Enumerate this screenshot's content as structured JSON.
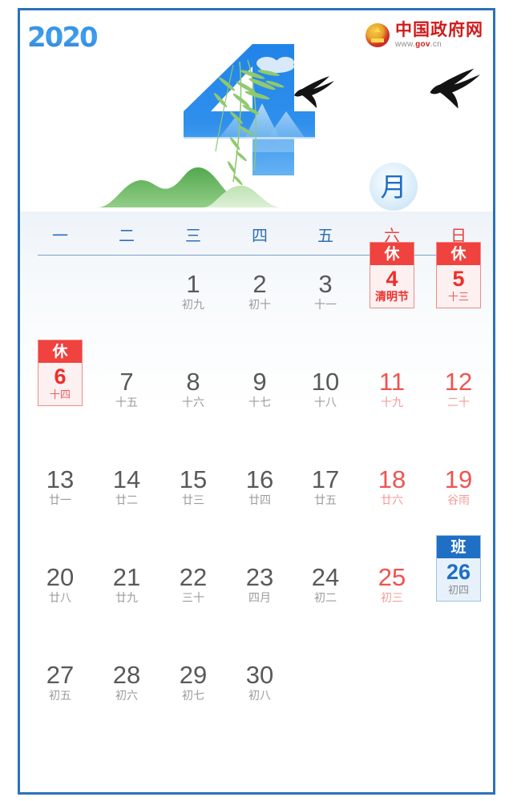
{
  "header": {
    "year_logo": "2020",
    "month_label": "月",
    "month_number": "4",
    "gov_logo": {
      "title": "中国政府网",
      "url_prefix": "www.",
      "url_mid": "gov",
      "url_suffix": ".cn"
    }
  },
  "weekdays": [
    {
      "label": "一",
      "weekend": false
    },
    {
      "label": "二",
      "weekend": false
    },
    {
      "label": "三",
      "weekend": false
    },
    {
      "label": "四",
      "weekend": false
    },
    {
      "label": "五",
      "weekend": false
    },
    {
      "label": "六",
      "weekend": true
    },
    {
      "label": "日",
      "weekend": true
    }
  ],
  "colors": {
    "frame": "#2a72bb",
    "weekday_blue": "#2f6fb5",
    "weekend_red": "#e8433f",
    "rest_red": "#f0423f",
    "work_blue": "#1f6fc4",
    "day_gray": "#59595b",
    "lunar_gray": "#9b9b9b"
  },
  "days": [
    {
      "num": "1",
      "lunar": "初九",
      "col": 4,
      "row": 1,
      "type": "normal"
    },
    {
      "num": "2",
      "lunar": "初十",
      "col": 5,
      "row": 1,
      "type": "normal"
    },
    {
      "num": "3",
      "lunar": "十一",
      "col": 6,
      "row": 1,
      "type": "normal"
    },
    {
      "num": "4",
      "lunar": "清明节",
      "tag": "休",
      "col": 7,
      "row": 1,
      "type": "rest",
      "festival": true
    },
    {
      "num": "5",
      "lunar": "十三",
      "tag": "休",
      "col": 8,
      "row": 1,
      "type": "rest"
    },
    {
      "num": "6",
      "lunar": "十四",
      "tag": "休",
      "col": 2,
      "row": 2,
      "type": "rest"
    },
    {
      "num": "7",
      "lunar": "十五",
      "col": 3,
      "row": 2,
      "type": "normal"
    },
    {
      "num": "8",
      "lunar": "十六",
      "col": 4,
      "row": 2,
      "type": "normal"
    },
    {
      "num": "9",
      "lunar": "十七",
      "col": 5,
      "row": 2,
      "type": "normal"
    },
    {
      "num": "10",
      "lunar": "十八",
      "col": 6,
      "row": 2,
      "type": "normal"
    },
    {
      "num": "11",
      "lunar": "十九",
      "col": 7,
      "row": 2,
      "type": "weekend"
    },
    {
      "num": "12",
      "lunar": "二十",
      "col": 8,
      "row": 2,
      "type": "weekend"
    },
    {
      "num": "13",
      "lunar": "廿一",
      "col": 2,
      "row": 3,
      "type": "normal"
    },
    {
      "num": "14",
      "lunar": "廿二",
      "col": 3,
      "row": 3,
      "type": "normal"
    },
    {
      "num": "15",
      "lunar": "廿三",
      "col": 4,
      "row": 3,
      "type": "normal"
    },
    {
      "num": "16",
      "lunar": "廿四",
      "col": 5,
      "row": 3,
      "type": "normal"
    },
    {
      "num": "17",
      "lunar": "廿五",
      "col": 6,
      "row": 3,
      "type": "normal"
    },
    {
      "num": "18",
      "lunar": "廿六",
      "col": 7,
      "row": 3,
      "type": "weekend"
    },
    {
      "num": "19",
      "lunar": "谷雨",
      "col": 8,
      "row": 3,
      "type": "weekend"
    },
    {
      "num": "20",
      "lunar": "廿八",
      "col": 2,
      "row": 4,
      "type": "normal"
    },
    {
      "num": "21",
      "lunar": "廿九",
      "col": 3,
      "row": 4,
      "type": "normal"
    },
    {
      "num": "22",
      "lunar": "三十",
      "col": 4,
      "row": 4,
      "type": "normal"
    },
    {
      "num": "23",
      "lunar": "四月",
      "col": 5,
      "row": 4,
      "type": "normal"
    },
    {
      "num": "24",
      "lunar": "初二",
      "col": 6,
      "row": 4,
      "type": "normal"
    },
    {
      "num": "25",
      "lunar": "初三",
      "col": 7,
      "row": 4,
      "type": "weekend"
    },
    {
      "num": "26",
      "lunar": "初四",
      "tag": "班",
      "col": 8,
      "row": 4,
      "type": "work"
    },
    {
      "num": "27",
      "lunar": "初五",
      "col": 2,
      "row": 5,
      "type": "normal"
    },
    {
      "num": "28",
      "lunar": "初六",
      "col": 3,
      "row": 5,
      "type": "normal"
    },
    {
      "num": "29",
      "lunar": "初七",
      "col": 4,
      "row": 5,
      "type": "normal"
    },
    {
      "num": "30",
      "lunar": "初八",
      "col": 5,
      "row": 5,
      "type": "normal"
    }
  ]
}
